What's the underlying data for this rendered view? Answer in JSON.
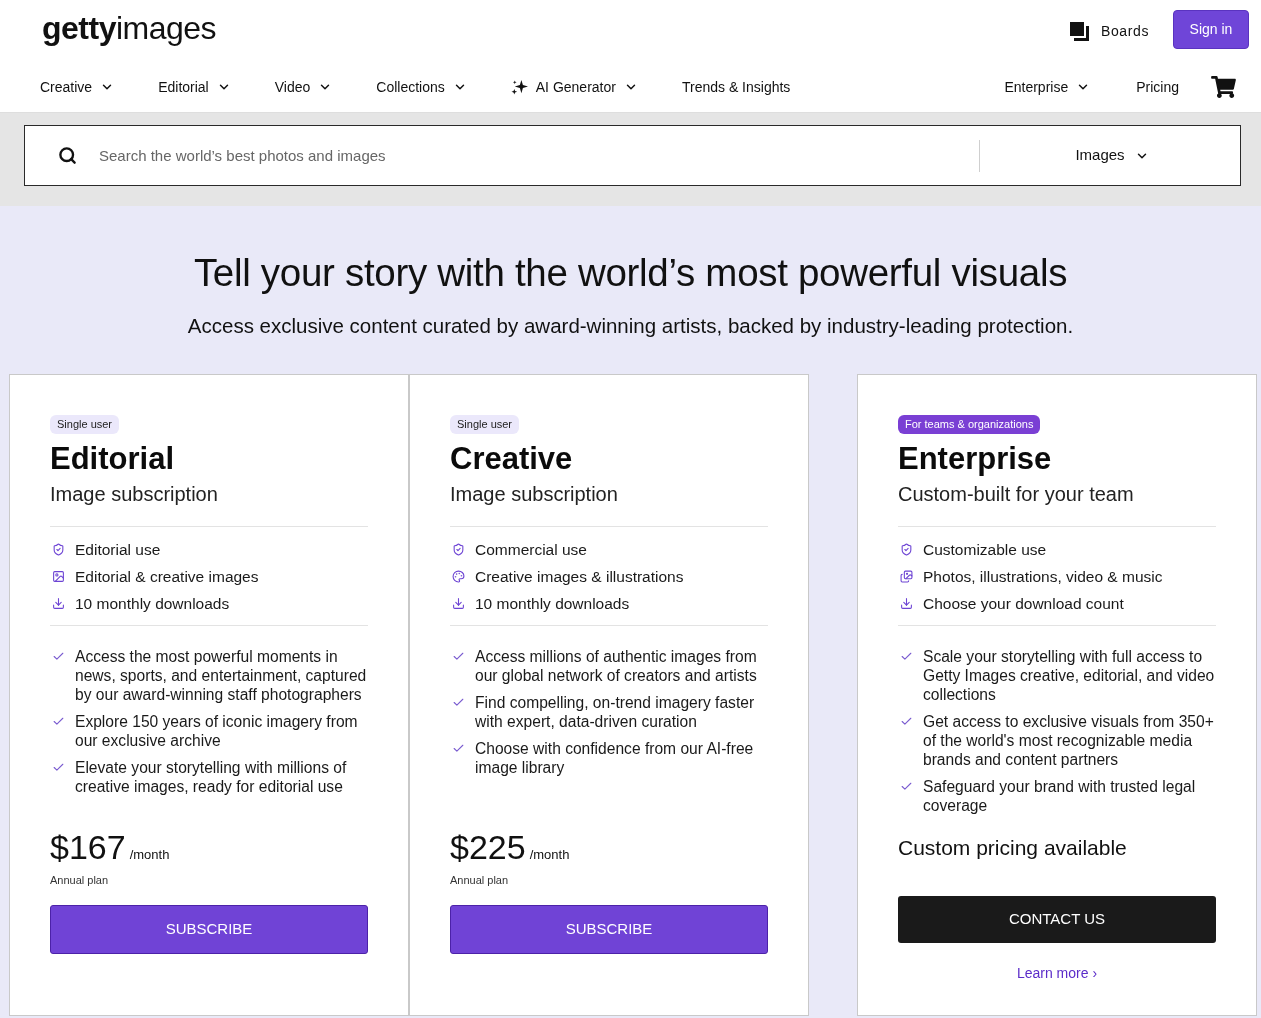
{
  "header": {
    "logo": "**getty**images",
    "boards": "Boards",
    "sign_in": "Sign in"
  },
  "nav": {
    "left": [
      {
        "label": "Creative",
        "has_menu": true,
        "kind": "link"
      },
      {
        "label": "Editorial",
        "has_menu": true,
        "kind": "link"
      },
      {
        "label": "Video",
        "has_menu": true,
        "kind": "link"
      },
      {
        "label": "Collections",
        "has_menu": true,
        "kind": "link"
      },
      {
        "label": "AI Generator",
        "has_menu": true,
        "kind": "ai"
      },
      {
        "label": "Trends & Insights",
        "has_menu": false,
        "kind": "link"
      }
    ],
    "right": [
      {
        "label": "Enterprise",
        "has_menu": true
      },
      {
        "label": "Pricing",
        "has_menu": false
      }
    ]
  },
  "search": {
    "placeholder": "Search the world’s best photos and images",
    "scope": "Images"
  },
  "hero": {
    "title": "Tell your story with the world’s most powerful visuals",
    "subtitle": "Access exclusive content curated by award-winning artists, backed by industry-leading protection."
  },
  "plans": [
    {
      "kind": "subscription",
      "badge": {
        "label": "Single user",
        "emphasis": false
      },
      "name": "Editorial",
      "tagline": "Image subscription",
      "features": [
        {
          "kind": "license",
          "text": "Editorial use"
        },
        {
          "kind": "images",
          "text": "Editorial & creative images"
        },
        {
          "kind": "downloads",
          "text": "10 monthly downloads"
        }
      ],
      "highlights": [
        "Access the most powerful moments in news, sports, and entertainment, captured by our award-winning staff photographers",
        "Explore 150 years of iconic imagery from our exclusive archive",
        "Elevate your storytelling with millions of creative images, ready for editorial use"
      ],
      "price": "$167",
      "period": "/month",
      "billing": "Annual plan",
      "cta": "SUBSCRIBE"
    },
    {
      "kind": "subscription",
      "badge": {
        "label": "Single user",
        "emphasis": false
      },
      "name": "Creative",
      "tagline": "Image subscription",
      "features": [
        {
          "kind": "license",
          "text": "Commercial use"
        },
        {
          "kind": "illustrations",
          "text": "Creative images & illustrations"
        },
        {
          "kind": "downloads",
          "text": "10 monthly downloads"
        }
      ],
      "highlights": [
        "Access millions of authentic images from our global network of creators and artists",
        "Find compelling, on-trend imagery faster with expert, data-driven curation",
        "Choose with confidence from our AI-free image library"
      ],
      "price": "$225",
      "period": "/month",
      "billing": "Annual plan",
      "cta": "SUBSCRIBE"
    },
    {
      "kind": "custom",
      "badge": {
        "label": "For teams & organizations",
        "emphasis": true
      },
      "name": "Enterprise",
      "tagline": "Custom-built for your team",
      "features": [
        {
          "kind": "license",
          "text": "Customizable use"
        },
        {
          "kind": "media",
          "text": "Photos, illustrations, video & music"
        },
        {
          "kind": "downloads",
          "text": "Choose your download count"
        }
      ],
      "highlights": [
        "Scale your storytelling with full access to Getty Images creative, editorial, and video collections",
        "Get access to exclusive visuals from 350+ of the world's most recognizable media brands and content partners",
        "Safeguard your brand with trusted legal coverage"
      ],
      "pricing_note": "Custom pricing available",
      "cta": "CONTACT US",
      "link": "Learn more ›"
    }
  ]
}
